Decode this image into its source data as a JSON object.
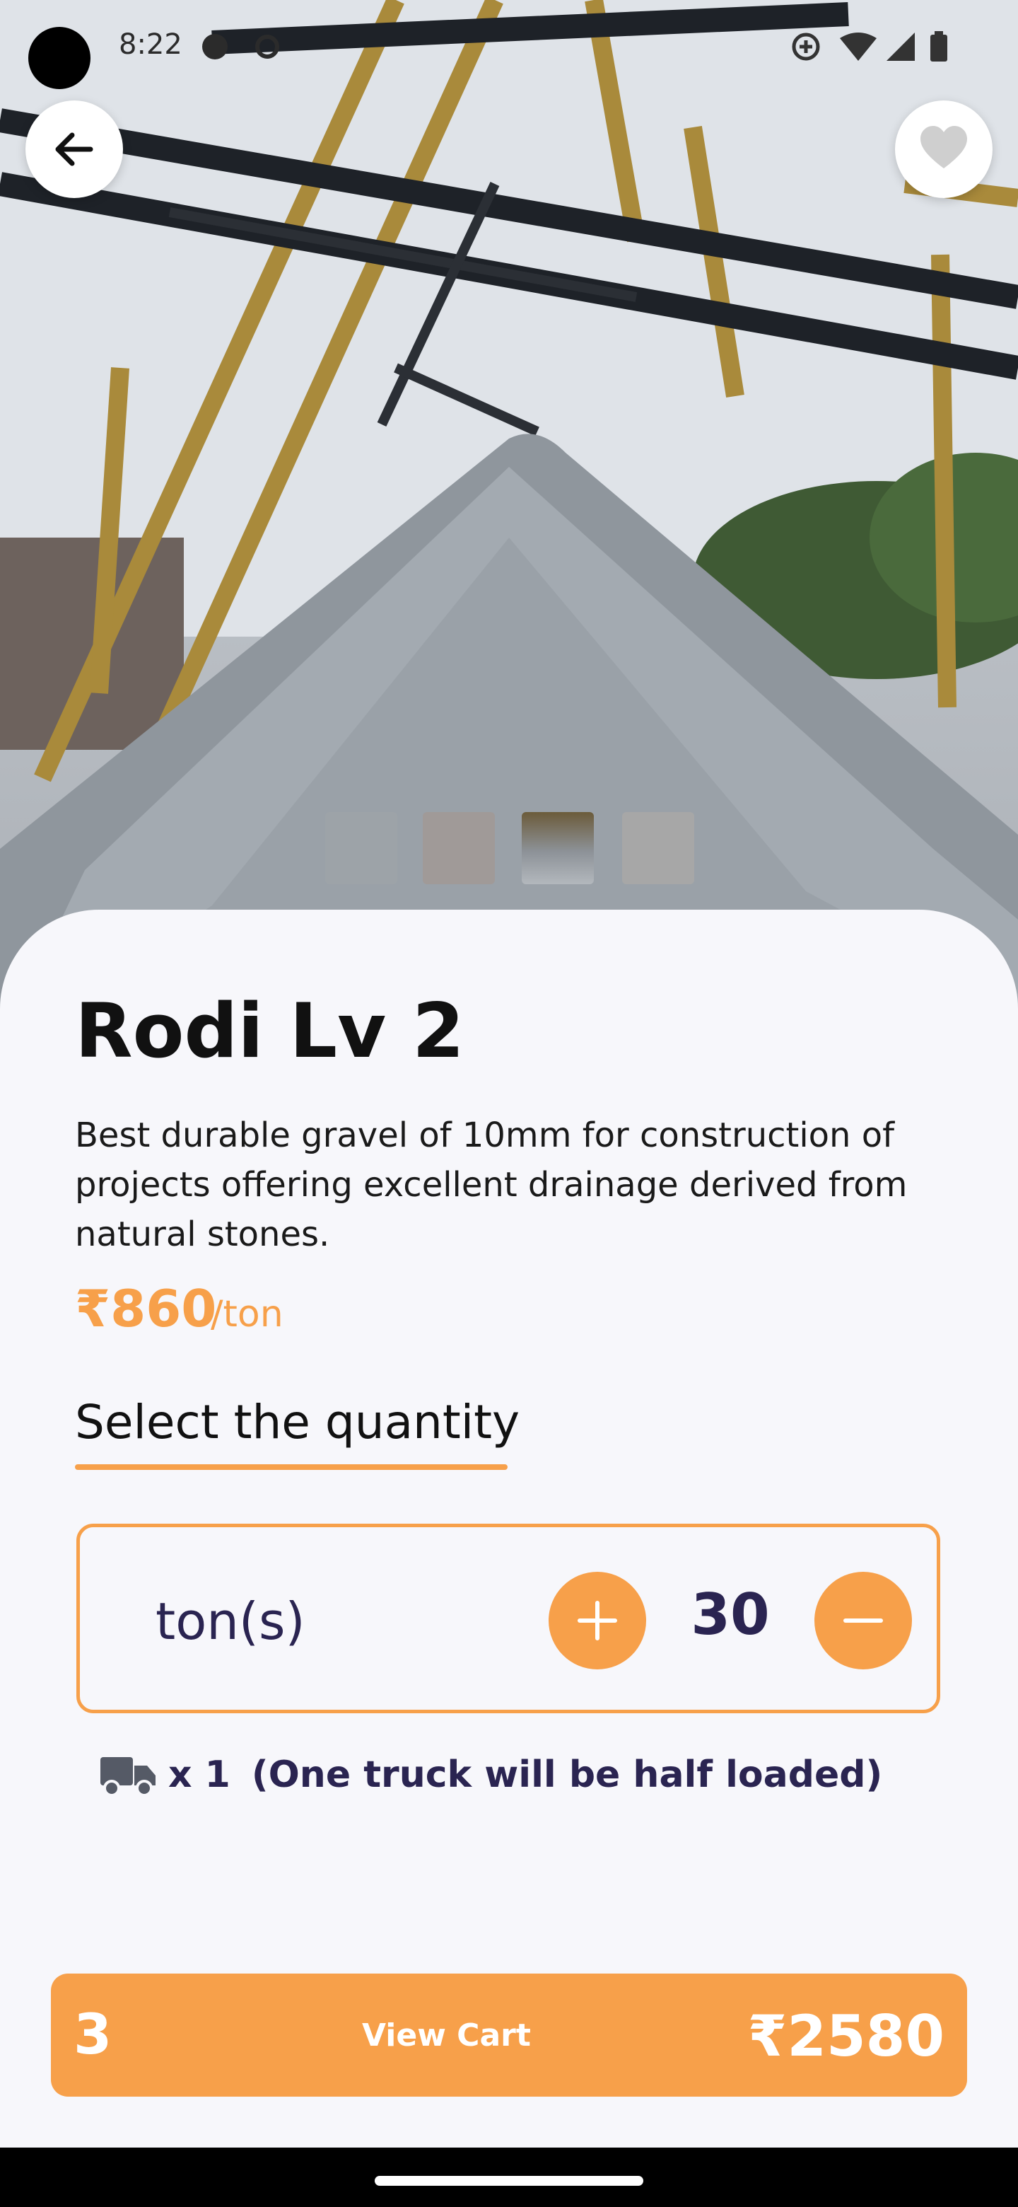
{
  "status_bar": {
    "time": "8:22"
  },
  "product": {
    "title": "Rodi Lv 2",
    "description": "Best durable gravel of 10mm for construction of projects offering excellent drainage derived from natural stones.",
    "price": "₹860",
    "price_unit": "/ton"
  },
  "quantity": {
    "section_label": "Select the quantity",
    "unit": "ton(s)",
    "value": "30",
    "truck_count": "x 1",
    "truck_note": "(One truck will be half loaded)"
  },
  "cart": {
    "count": "3",
    "label": "View Cart",
    "total": "₹2580"
  },
  "icons": {
    "back": "arrow-left-icon",
    "favorite": "heart-icon",
    "increment": "plus-icon",
    "decrement": "minus-icon",
    "truck": "truck-icon"
  },
  "colors": {
    "accent": "#f7a04a",
    "text_dark": "#2a2451"
  }
}
